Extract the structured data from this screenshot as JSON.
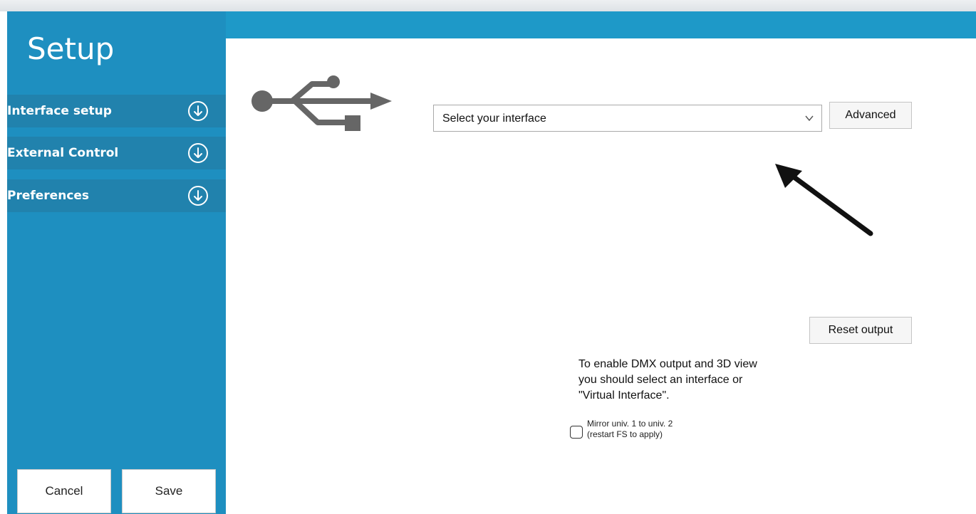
{
  "sidebar": {
    "title": "Setup",
    "items": [
      {
        "label": "Interface setup",
        "icon": "circle-arrow-down-icon"
      },
      {
        "label": "External Control",
        "icon": "circle-arrow-down-icon"
      },
      {
        "label": "Preferences",
        "icon": "circle-arrow-down-icon"
      }
    ],
    "cancel_label": "Cancel",
    "save_label": "Save"
  },
  "main": {
    "usb_icon": "usb-icon",
    "interface_select": {
      "value": "Select your interface"
    },
    "advanced_label": "Advanced",
    "reset_output_label": "Reset output",
    "hint_lines": [
      "To enable DMX output and 3D view",
      "you should select an interface or",
      "\"Virtual Interface\"."
    ],
    "mirror": {
      "checked": false,
      "line1": "Mirror univ. 1 to univ. 2",
      "line2": "(restart FS to apply)"
    }
  },
  "annotation": {
    "icon": "arrow-pointer-icon"
  },
  "colors": {
    "sidebar": "#1e8fc0",
    "sidebar_item": "#2182ad",
    "topbar": "#1e99c8"
  }
}
